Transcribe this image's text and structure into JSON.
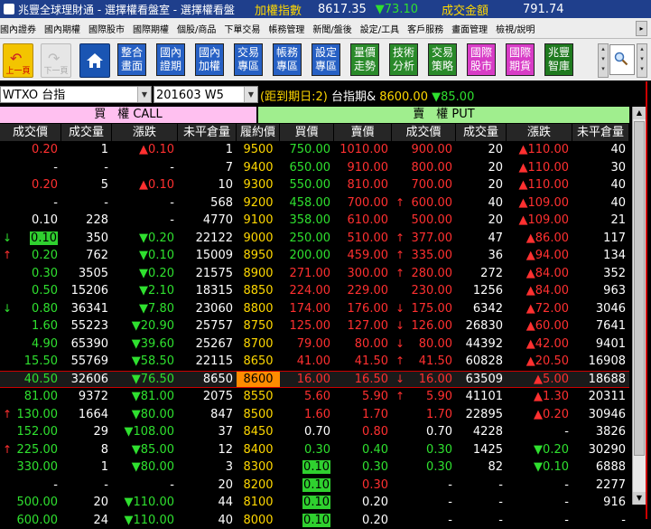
{
  "titlebar": {
    "title": "兆豐全球理財通 - 選擇權看盤室 - 選擇權看盤",
    "index_label": "加權指數",
    "index_value": "8617.35",
    "index_change": "▼73.10",
    "amount_label": "成交金額",
    "amount_value": "791.74"
  },
  "menu": [
    "國內證券",
    "國內期權",
    "國際股市",
    "國際期權",
    "個股/商品",
    "下單交易",
    "帳務管理",
    "新聞/盤後",
    "設定/工具",
    "客戶服務",
    "畫面管理",
    "檢視/說明"
  ],
  "toolbar": {
    "prev_label": "上一頁",
    "next_label": "下一頁",
    "buttons": [
      {
        "l1": "整合",
        "l2": "畫面",
        "color": "blue"
      },
      {
        "l1": "國內",
        "l2": "證期",
        "color": "blue"
      },
      {
        "l1": "國內",
        "l2": "加權",
        "color": "blue"
      },
      {
        "l1": "交易",
        "l2": "專區",
        "color": "blue"
      },
      {
        "l1": "帳務",
        "l2": "專區",
        "color": "blue"
      },
      {
        "l1": "設定",
        "l2": "專區",
        "color": "blue"
      },
      {
        "l1": "量價",
        "l2": "走勢",
        "color": "green"
      },
      {
        "l1": "技術",
        "l2": "分析",
        "color": "green"
      },
      {
        "l1": "交易",
        "l2": "策略",
        "color": "green"
      },
      {
        "l1": "國際",
        "l2": "股市",
        "color": "pink"
      },
      {
        "l1": "國際",
        "l2": "期貨",
        "color": "pink"
      },
      {
        "l1": "兆豐",
        "l2": "智庫",
        "color": "dgreen"
      }
    ]
  },
  "query": {
    "product": "WTXO 台指",
    "contract": "201603 W5",
    "days_to_expiry": "(距到期日:2)",
    "underlying_label": "台指期&",
    "underlying_price": "8600.00",
    "underlying_change": "▼85.00"
  },
  "headers": {
    "call": "買　權 CALL",
    "put": "賣　權 PUT",
    "columns": [
      "成交價",
      "成交量",
      "漲跌",
      "未平倉量",
      "履約價",
      "買價",
      "賣價",
      "成交價",
      "成交量",
      "漲跌",
      "未平倉量"
    ]
  },
  "rows": [
    {
      "c_arrow": "",
      "c_price": "0.20",
      "c_pcolor": "red",
      "c_vol": "1",
      "c_chg": "▲0.10",
      "c_ccolor": "red",
      "c_oi": "1",
      "strike": "9500",
      "p_bid": "750.00",
      "p_ask": "1010.00",
      "p_arrow": "",
      "p_price": "900.00",
      "p_vol": "20",
      "p_chg": "▲110.00",
      "p_oi": "40",
      "p_pcolor": "red",
      "p_ccolor": "red",
      "p_bidcolor": "grn",
      "p_askcolor": "red"
    },
    {
      "c_arrow": "",
      "c_price": "-",
      "c_pcolor": "wht",
      "c_vol": "-",
      "c_chg": "-",
      "c_ccolor": "wht",
      "c_oi": "7",
      "strike": "9400",
      "p_bid": "650.00",
      "p_ask": "910.00",
      "p_arrow": "",
      "p_price": "800.00",
      "p_vol": "20",
      "p_chg": "▲110.00",
      "p_oi": "30",
      "p_pcolor": "red",
      "p_ccolor": "red",
      "p_bidcolor": "grn",
      "p_askcolor": "red"
    },
    {
      "c_arrow": "",
      "c_price": "0.20",
      "c_pcolor": "red",
      "c_vol": "5",
      "c_chg": "▲0.10",
      "c_ccolor": "red",
      "c_oi": "10",
      "strike": "9300",
      "p_bid": "550.00",
      "p_ask": "810.00",
      "p_arrow": "",
      "p_price": "700.00",
      "p_vol": "20",
      "p_chg": "▲110.00",
      "p_oi": "40",
      "p_pcolor": "red",
      "p_ccolor": "red",
      "p_bidcolor": "grn",
      "p_askcolor": "red"
    },
    {
      "c_arrow": "",
      "c_price": "-",
      "c_pcolor": "wht",
      "c_vol": "-",
      "c_chg": "-",
      "c_ccolor": "wht",
      "c_oi": "568",
      "strike": "9200",
      "p_bid": "458.00",
      "p_ask": "700.00",
      "p_arrow": "↑",
      "p_price": "600.00",
      "p_vol": "40",
      "p_chg": "▲109.00",
      "p_oi": "40",
      "p_pcolor": "red",
      "p_ccolor": "red",
      "p_bidcolor": "grn",
      "p_askcolor": "red"
    },
    {
      "c_arrow": "",
      "c_price": "0.10",
      "c_pcolor": "wht",
      "c_vol": "228",
      "c_chg": "-",
      "c_ccolor": "wht",
      "c_oi": "4770",
      "strike": "9100",
      "p_bid": "358.00",
      "p_ask": "610.00",
      "p_arrow": "",
      "p_price": "500.00",
      "p_vol": "20",
      "p_chg": "▲109.00",
      "p_oi": "21",
      "p_pcolor": "red",
      "p_ccolor": "red",
      "p_bidcolor": "grn",
      "p_askcolor": "red"
    },
    {
      "c_arrow": "↓",
      "c_price": "0.10",
      "c_pcolor": "box",
      "c_vol": "350",
      "c_chg": "▼0.20",
      "c_ccolor": "grn",
      "c_oi": "22122",
      "strike": "9000",
      "p_bid": "250.00",
      "p_ask": "510.00",
      "p_arrow": "↑",
      "p_price": "377.00",
      "p_vol": "47",
      "p_chg": "▲86.00",
      "p_oi": "117",
      "p_pcolor": "red",
      "p_ccolor": "red",
      "p_bidcolor": "grn",
      "p_askcolor": "red"
    },
    {
      "c_arrow": "↑",
      "c_price": "0.20",
      "c_pcolor": "grn",
      "c_vol": "762",
      "c_chg": "▼0.10",
      "c_ccolor": "grn",
      "c_oi": "15009",
      "strike": "8950",
      "p_bid": "200.00",
      "p_ask": "459.00",
      "p_arrow": "↑",
      "p_price": "335.00",
      "p_vol": "36",
      "p_chg": "▲94.00",
      "p_oi": "134",
      "p_pcolor": "red",
      "p_ccolor": "red",
      "p_bidcolor": "grn",
      "p_askcolor": "red"
    },
    {
      "c_arrow": "",
      "c_price": "0.30",
      "c_pcolor": "grn",
      "c_vol": "3505",
      "c_chg": "▼0.20",
      "c_ccolor": "grn",
      "c_oi": "21575",
      "strike": "8900",
      "p_bid": "271.00",
      "p_ask": "300.00",
      "p_arrow": "↑",
      "p_price": "280.00",
      "p_vol": "272",
      "p_chg": "▲84.00",
      "p_oi": "352",
      "p_pcolor": "red",
      "p_ccolor": "red",
      "p_bidcolor": "red",
      "p_askcolor": "red"
    },
    {
      "c_arrow": "",
      "c_price": "0.50",
      "c_pcolor": "grn",
      "c_vol": "15206",
      "c_chg": "▼2.10",
      "c_ccolor": "grn",
      "c_oi": "18315",
      "strike": "8850",
      "p_bid": "224.00",
      "p_ask": "229.00",
      "p_arrow": "",
      "p_price": "230.00",
      "p_vol": "1256",
      "p_chg": "▲84.00",
      "p_oi": "963",
      "p_pcolor": "red",
      "p_ccolor": "red",
      "p_bidcolor": "red",
      "p_askcolor": "red"
    },
    {
      "c_arrow": "↓",
      "c_price": "0.80",
      "c_pcolor": "grn",
      "c_vol": "36341",
      "c_chg": "▼7.80",
      "c_ccolor": "grn",
      "c_oi": "23060",
      "strike": "8800",
      "p_bid": "174.00",
      "p_ask": "176.00",
      "p_arrow": "↓",
      "p_price": "175.00",
      "p_vol": "6342",
      "p_chg": "▲72.00",
      "p_oi": "3046",
      "p_pcolor": "red",
      "p_ccolor": "red",
      "p_bidcolor": "red",
      "p_askcolor": "red"
    },
    {
      "c_arrow": "",
      "c_price": "1.60",
      "c_pcolor": "grn",
      "c_vol": "55223",
      "c_chg": "▼20.90",
      "c_ccolor": "grn",
      "c_oi": "25757",
      "strike": "8750",
      "p_bid": "125.00",
      "p_ask": "127.00",
      "p_arrow": "↓",
      "p_price": "126.00",
      "p_vol": "26830",
      "p_chg": "▲60.00",
      "p_oi": "7641",
      "p_pcolor": "red",
      "p_ccolor": "red",
      "p_bidcolor": "red",
      "p_askcolor": "red"
    },
    {
      "c_arrow": "",
      "c_price": "4.90",
      "c_pcolor": "grn",
      "c_vol": "65390",
      "c_chg": "▼39.60",
      "c_ccolor": "grn",
      "c_oi": "25267",
      "strike": "8700",
      "p_bid": "79.00",
      "p_ask": "80.00",
      "p_arrow": "↓",
      "p_price": "80.00",
      "p_vol": "44392",
      "p_chg": "▲42.00",
      "p_oi": "9401",
      "p_pcolor": "red",
      "p_ccolor": "red",
      "p_bidcolor": "red",
      "p_askcolor": "red"
    },
    {
      "c_arrow": "",
      "c_price": "15.50",
      "c_pcolor": "grn",
      "c_vol": "55769",
      "c_chg": "▼58.50",
      "c_ccolor": "grn",
      "c_oi": "22115",
      "strike": "8650",
      "p_bid": "41.00",
      "p_ask": "41.50",
      "p_arrow": "↑",
      "p_price": "41.50",
      "p_vol": "60828",
      "p_chg": "▲20.50",
      "p_oi": "16908",
      "p_pcolor": "red",
      "p_ccolor": "red",
      "p_bidcolor": "red",
      "p_askcolor": "red"
    },
    {
      "c_arrow": "",
      "c_price": "40.50",
      "c_pcolor": "grn",
      "c_vol": "32606",
      "c_chg": "▼76.50",
      "c_ccolor": "grn",
      "c_oi": "8650",
      "strike": "8600",
      "p_bid": "16.00",
      "p_ask": "16.50",
      "p_arrow": "↓",
      "p_price": "16.00",
      "p_vol": "63509",
      "p_chg": "▲5.00",
      "p_oi": "18688",
      "p_pcolor": "red",
      "p_ccolor": "red",
      "p_bidcolor": "red",
      "p_askcolor": "red",
      "atm": true
    },
    {
      "c_arrow": "",
      "c_price": "81.00",
      "c_pcolor": "grn",
      "c_vol": "9372",
      "c_chg": "▼81.00",
      "c_ccolor": "grn",
      "c_oi": "2075",
      "strike": "8550",
      "p_bid": "5.60",
      "p_ask": "5.90",
      "p_arrow": "↑",
      "p_price": "5.90",
      "p_vol": "41101",
      "p_chg": "▲1.30",
      "p_oi": "20311",
      "p_pcolor": "red",
      "p_ccolor": "red",
      "p_bidcolor": "red",
      "p_askcolor": "red"
    },
    {
      "c_arrow": "↑",
      "c_price": "130.00",
      "c_pcolor": "grn",
      "c_vol": "1664",
      "c_chg": "▼80.00",
      "c_ccolor": "grn",
      "c_oi": "847",
      "strike": "8500",
      "p_bid": "1.60",
      "p_ask": "1.70",
      "p_arrow": "",
      "p_price": "1.70",
      "p_vol": "22895",
      "p_chg": "▲0.20",
      "p_oi": "30946",
      "p_pcolor": "red",
      "p_ccolor": "red",
      "p_bidcolor": "red",
      "p_askcolor": "red"
    },
    {
      "c_arrow": "",
      "c_price": "152.00",
      "c_pcolor": "grn",
      "c_vol": "29",
      "c_chg": "▼108.00",
      "c_ccolor": "grn",
      "c_oi": "37",
      "strike": "8450",
      "p_bid": "0.70",
      "p_ask": "0.80",
      "p_arrow": "",
      "p_price": "0.70",
      "p_vol": "4228",
      "p_chg": "-",
      "p_oi": "3826",
      "p_pcolor": "wht",
      "p_ccolor": "wht",
      "p_bidcolor": "wht",
      "p_askcolor": "red"
    },
    {
      "c_arrow": "↑",
      "c_price": "225.00",
      "c_pcolor": "grn",
      "c_vol": "8",
      "c_chg": "▼85.00",
      "c_ccolor": "grn",
      "c_oi": "12",
      "strike": "8400",
      "p_bid": "0.30",
      "p_ask": "0.40",
      "p_arrow": "",
      "p_price": "0.30",
      "p_vol": "1425",
      "p_chg": "▼0.20",
      "p_oi": "30290",
      "p_pcolor": "grn",
      "p_ccolor": "grn",
      "p_bidcolor": "grn",
      "p_askcolor": "grn"
    },
    {
      "c_arrow": "",
      "c_price": "330.00",
      "c_pcolor": "grn",
      "c_vol": "1",
      "c_chg": "▼80.00",
      "c_ccolor": "grn",
      "c_oi": "3",
      "strike": "8300",
      "p_bid": "0.10",
      "p_ask": "0.30",
      "p_arrow": "",
      "p_price": "0.30",
      "p_vol": "82",
      "p_chg": "▼0.10",
      "p_oi": "6888",
      "p_pcolor": "grn",
      "p_ccolor": "grn",
      "p_bidcolor": "box",
      "p_askcolor": "grn"
    },
    {
      "c_arrow": "",
      "c_price": "-",
      "c_pcolor": "wht",
      "c_vol": "-",
      "c_chg": "-",
      "c_ccolor": "wht",
      "c_oi": "20",
      "strike": "8200",
      "p_bid": "0.10",
      "p_ask": "0.30",
      "p_arrow": "",
      "p_price": "-",
      "p_vol": "-",
      "p_chg": "-",
      "p_oi": "2277",
      "p_pcolor": "wht",
      "p_ccolor": "wht",
      "p_bidcolor": "box",
      "p_askcolor": "red"
    },
    {
      "c_arrow": "",
      "c_price": "500.00",
      "c_pcolor": "grn",
      "c_vol": "20",
      "c_chg": "▼110.00",
      "c_ccolor": "grn",
      "c_oi": "44",
      "strike": "8100",
      "p_bid": "0.10",
      "p_ask": "0.20",
      "p_arrow": "",
      "p_price": "-",
      "p_vol": "-",
      "p_chg": "-",
      "p_oi": "916",
      "p_pcolor": "wht",
      "p_ccolor": "wht",
      "p_bidcolor": "box",
      "p_askcolor": "wht"
    },
    {
      "c_arrow": "",
      "c_price": "600.00",
      "c_pcolor": "grn",
      "c_vol": "24",
      "c_chg": "▼110.00",
      "c_ccolor": "grn",
      "c_oi": "40",
      "strike": "8000",
      "p_bid": "0.10",
      "p_ask": "0.20",
      "p_arrow": "",
      "p_price": "-",
      "p_vol": "-",
      "p_chg": "-",
      "p_oi": "-",
      "p_pcolor": "wht",
      "p_ccolor": "wht",
      "p_bidcolor": "box",
      "p_askcolor": "wht"
    }
  ],
  "colors": {
    "up": "#ff3030",
    "down": "#2fe02f",
    "flat": "#ffffff",
    "strike": "#ffd800",
    "atm": "#ff8c00",
    "call_header": "#ffc0f0",
    "put_header": "#a0ee8e"
  }
}
